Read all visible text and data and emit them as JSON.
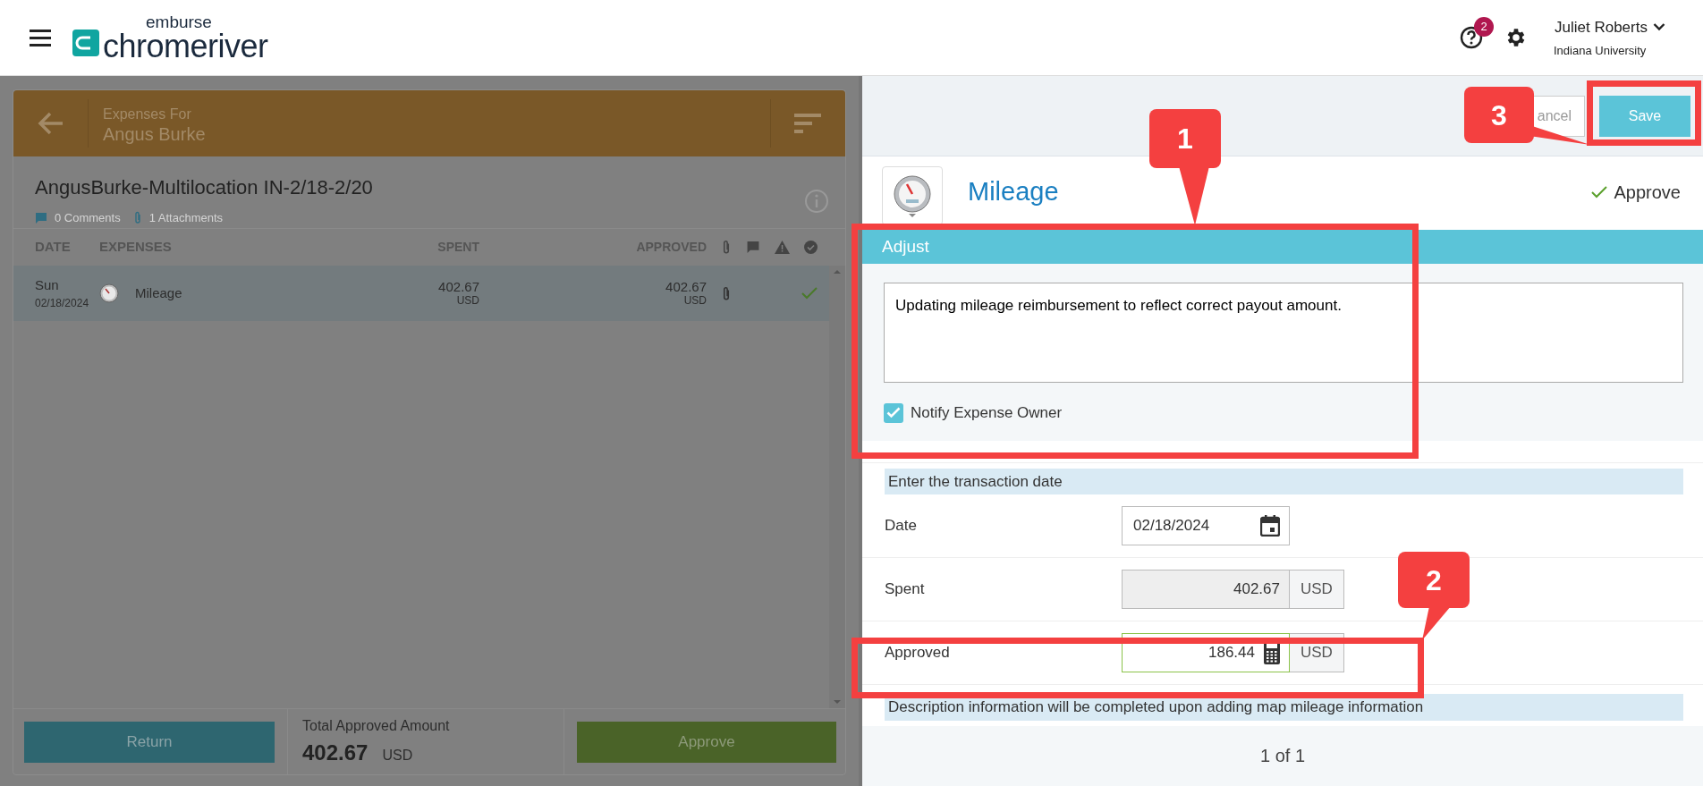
{
  "header": {
    "brand_top": "emburse",
    "brand": "chromeriver",
    "help_badge": "2",
    "user_name": "Juliet Roberts",
    "user_org": "Indiana University"
  },
  "report": {
    "expenses_for_label": "Expenses For",
    "owner": "Angus Burke",
    "title": "AngusBurke-Multilocation IN-2/18-2/20",
    "comments": "0 Comments",
    "attachments": "1 Attachments",
    "columns": [
      "DATE",
      "EXPENSES",
      "SPENT",
      "APPROVED"
    ],
    "rows": [
      {
        "day": "Sun",
        "date": "02/18/2024",
        "expense": "Mileage",
        "spent": "402.67",
        "spent_currency": "USD",
        "approved": "402.67",
        "approved_currency": "USD",
        "has_attachment": true,
        "approved_check": true,
        "selected": true
      }
    ],
    "footer": {
      "return": "Return",
      "total_label": "Total Approved Amount",
      "total": "402.67",
      "total_currency": "USD",
      "approve": "Approve"
    }
  },
  "detail": {
    "cancel": "ancel",
    "save": "Save",
    "title": "Mileage",
    "approve": "Approve",
    "adjust_title": "Adjust",
    "comment": "Updating mileage reimbursement to reflect correct payout amount.",
    "notify_label": "Notify Expense Owner",
    "notify_checked": true,
    "date_hint": "Enter the transaction date",
    "fields": [
      {
        "label": "Date",
        "value": "02/18/2024",
        "kind": "date"
      },
      {
        "label": "Spent",
        "value": "402.67",
        "currency": "USD",
        "kind": "readonly"
      },
      {
        "label": "Approved",
        "value": "186.44",
        "currency": "USD",
        "kind": "calc"
      }
    ],
    "description_hint": "Description information will be completed upon adding map mileage information",
    "pager": "1 of 1"
  },
  "annotations": [
    {
      "label": "1"
    },
    {
      "label": "2"
    },
    {
      "label": "3"
    }
  ]
}
